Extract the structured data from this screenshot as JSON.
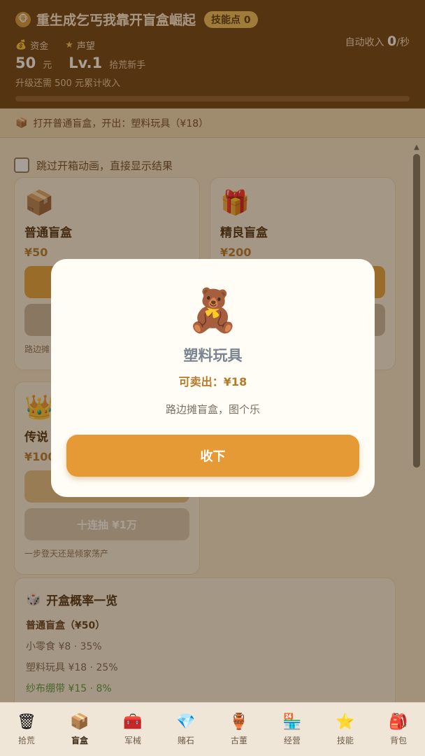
{
  "header": {
    "title": "重生成乞丐我靠开盲盒崛起",
    "skill_points_label": "技能点 0",
    "money_label": "资金",
    "reputation_label": "声望",
    "money_value": "50",
    "money_unit": "元",
    "level": "Lv.1",
    "rank": "拾荒新手",
    "auto_income_label": "自动收入",
    "auto_income_value": "0",
    "auto_income_unit": "/秒",
    "upgrade_text": "升级还需 500 元累计收入",
    "progress_fraction": 0
  },
  "log": {
    "text": "打开普通盲盒，开出：塑料玩具（¥18）"
  },
  "options": {
    "skip_animation": "跳过开箱动画，直接显示结果"
  },
  "boxes": [
    {
      "icon": "box-icon",
      "name": "普通盲盒",
      "price": "¥50",
      "desc": "路边摊"
    },
    {
      "icon": "gift-icon",
      "name": "精良盲盒",
      "price": "¥200"
    },
    {
      "icon": "crown-icon",
      "name": "传说",
      "price": "¥100",
      "ten_draw": "十连抽 ¥1万",
      "desc": "一步登天还是倾家荡产"
    }
  ],
  "probabilities": {
    "title": "开盒概率一览",
    "section": "普通盲盒（¥50）",
    "items": [
      "小零食 ¥8 · 35%",
      "塑料玩具 ¥18 · 25%",
      "纱布绷带 ¥15 · 8%"
    ]
  },
  "modal": {
    "icon": "teddy-bear-icon",
    "item_name": "塑料玩具",
    "sell_price": "可卖出：¥18",
    "description": "路边摊盲盒，图个乐",
    "accept_label": "收下"
  },
  "nav": [
    {
      "label": "拾荒",
      "icon": "trash-can-icon"
    },
    {
      "label": "盲盒",
      "icon": "box-icon"
    },
    {
      "label": "军械",
      "icon": "toolbox-icon"
    },
    {
      "label": "赌石",
      "icon": "gem-icon"
    },
    {
      "label": "古董",
      "icon": "vase-icon"
    },
    {
      "label": "经营",
      "icon": "shop-icon"
    },
    {
      "label": "技能",
      "icon": "star-icon"
    },
    {
      "label": "背包",
      "icon": "backpack-icon"
    }
  ],
  "colors": {
    "header_bg": "#6b3f12",
    "accent": "#e69a35",
    "gold": "#b57a2a"
  }
}
